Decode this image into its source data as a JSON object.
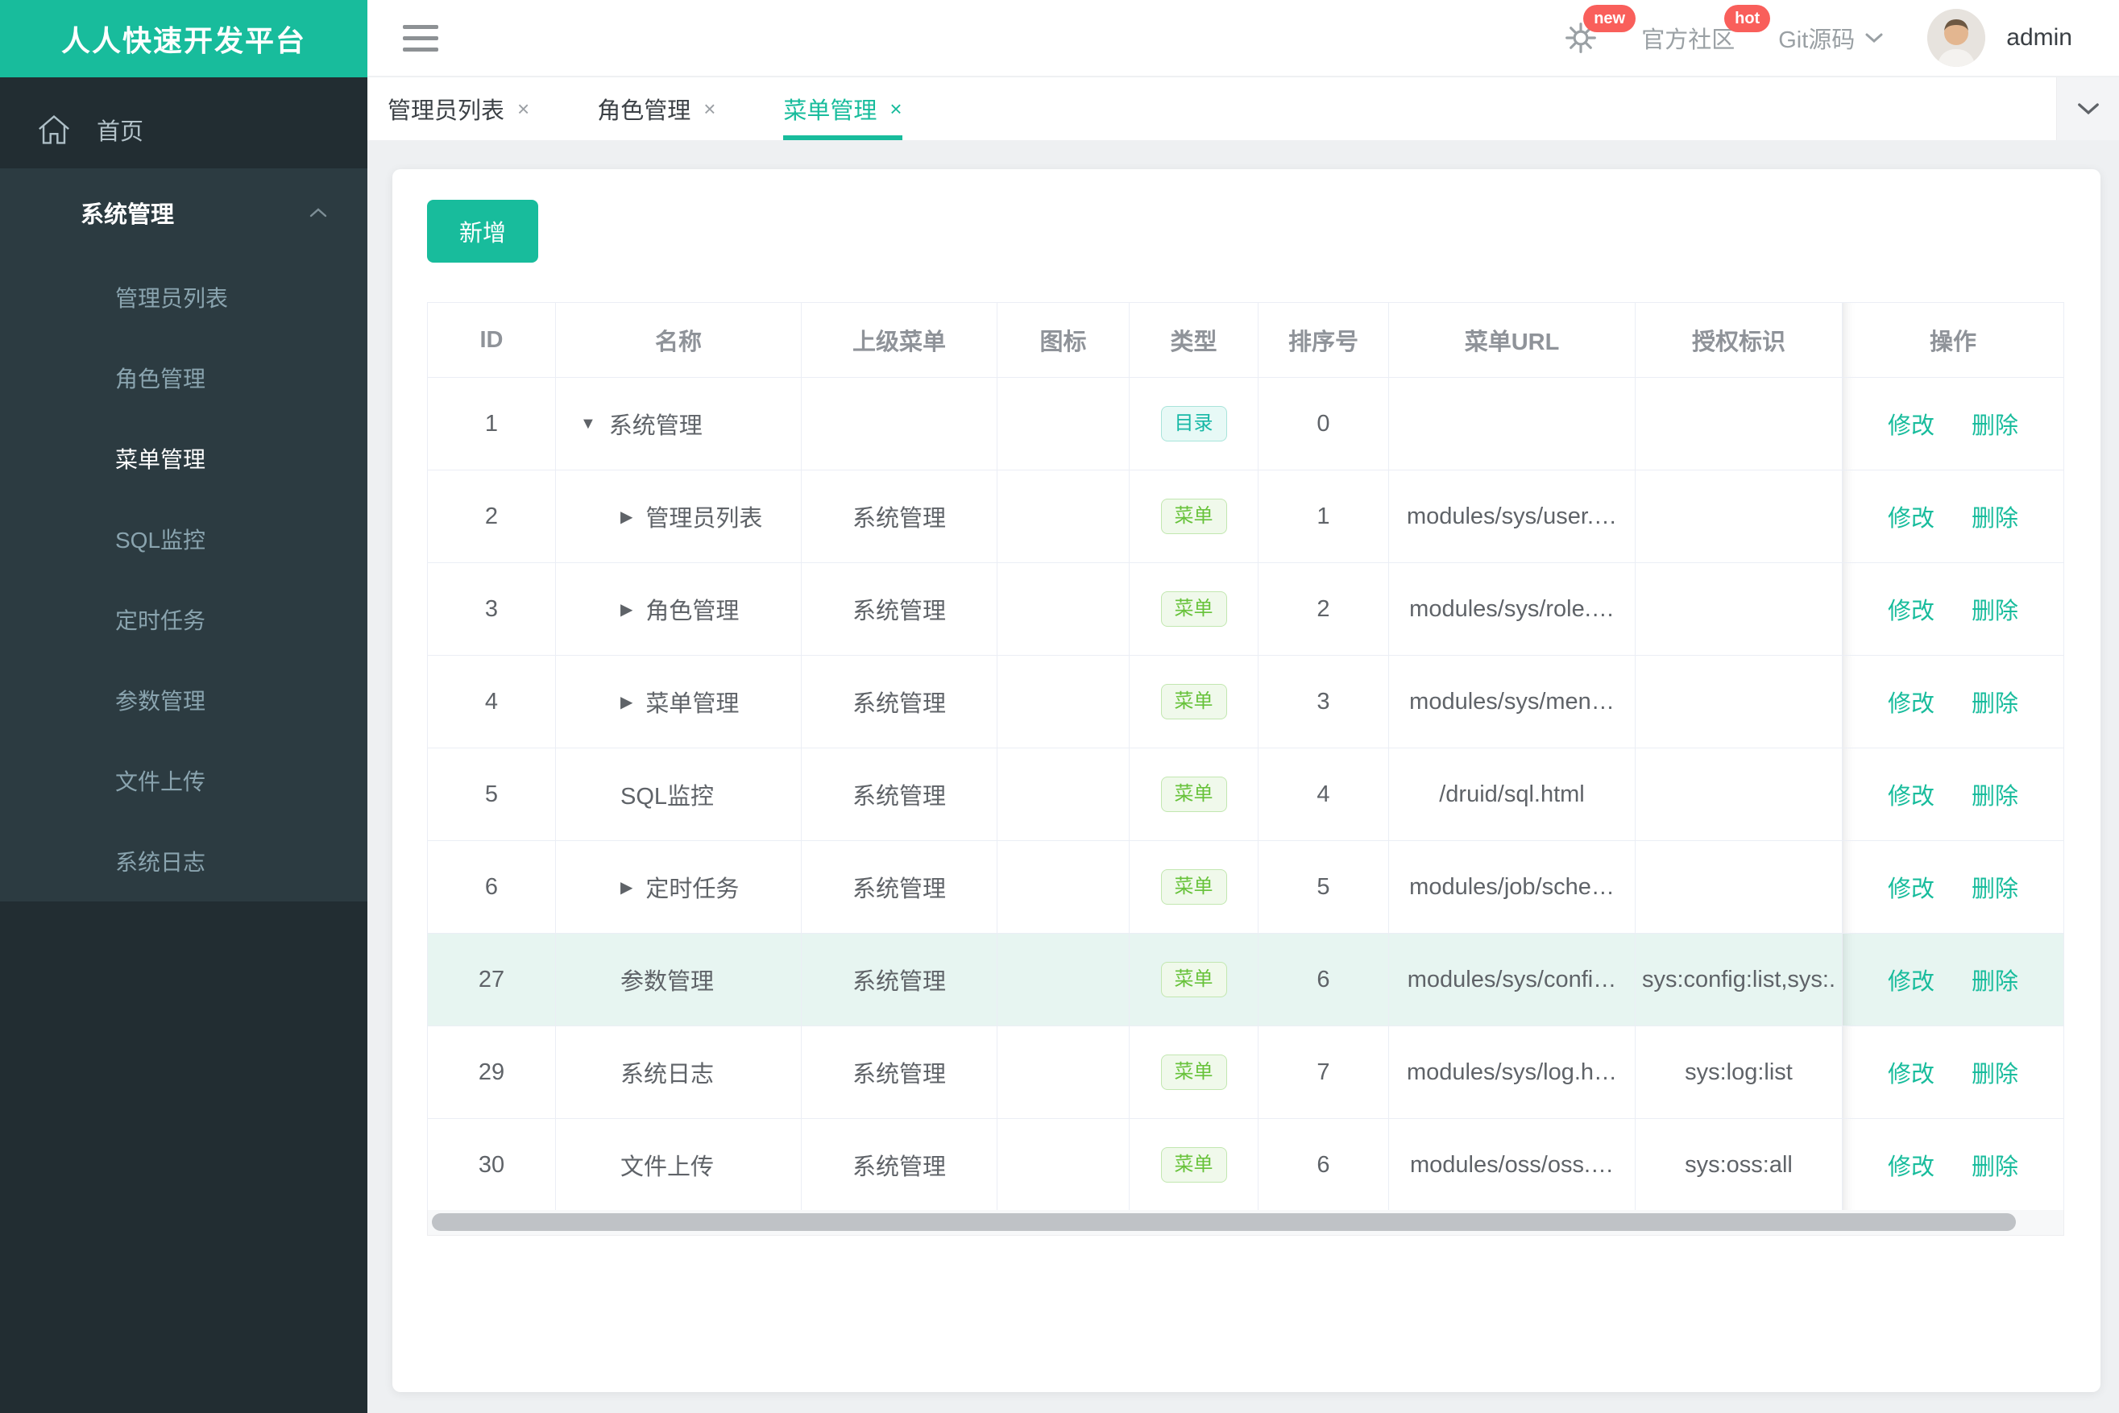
{
  "app": {
    "title": "人人快速开发平台"
  },
  "header": {
    "badge_new": "new",
    "community": "官方社区",
    "badge_hot": "hot",
    "git": "Git源码",
    "username": "admin"
  },
  "sidebar": {
    "home": "首页",
    "group": "系统管理",
    "items": [
      {
        "label": "管理员列表",
        "active": false
      },
      {
        "label": "角色管理",
        "active": false
      },
      {
        "label": "菜单管理",
        "active": true
      },
      {
        "label": "SQL监控",
        "active": false
      },
      {
        "label": "定时任务",
        "active": false
      },
      {
        "label": "参数管理",
        "active": false
      },
      {
        "label": "文件上传",
        "active": false
      },
      {
        "label": "系统日志",
        "active": false
      }
    ]
  },
  "tabs": [
    {
      "label": "管理员列表",
      "active": false
    },
    {
      "label": "角色管理",
      "active": false
    },
    {
      "label": "菜单管理",
      "active": true
    }
  ],
  "toolbar": {
    "add_label": "新增"
  },
  "icons": {
    "close_tab": "×",
    "row_collapsed": "▶",
    "row_expanded": "▼"
  },
  "table": {
    "columns": [
      "ID",
      "名称",
      "上级菜单",
      "图标",
      "类型",
      "排序号",
      "菜单URL",
      "授权标识",
      "操作"
    ],
    "types": {
      "dir": "目录",
      "menu": "菜单"
    },
    "actions": {
      "edit": "修改",
      "delete": "删除"
    },
    "rows": [
      {
        "id": "1",
        "name": "系统管理",
        "arrow": "expanded",
        "level": 0,
        "parent": "",
        "type": "dir",
        "order": "0",
        "url": "",
        "perms": "",
        "highlight": false
      },
      {
        "id": "2",
        "name": "管理员列表",
        "arrow": "collapsed",
        "level": 1,
        "parent": "系统管理",
        "type": "menu",
        "order": "1",
        "url": "modules/sys/user.…",
        "perms": "",
        "highlight": false
      },
      {
        "id": "3",
        "name": "角色管理",
        "arrow": "collapsed",
        "level": 1,
        "parent": "系统管理",
        "type": "menu",
        "order": "2",
        "url": "modules/sys/role.…",
        "perms": "",
        "highlight": false
      },
      {
        "id": "4",
        "name": "菜单管理",
        "arrow": "collapsed",
        "level": 1,
        "parent": "系统管理",
        "type": "menu",
        "order": "3",
        "url": "modules/sys/men…",
        "perms": "",
        "highlight": false
      },
      {
        "id": "5",
        "name": "SQL监控",
        "arrow": "none",
        "level": 1,
        "parent": "系统管理",
        "type": "menu",
        "order": "4",
        "url": "/druid/sql.html",
        "perms": "",
        "highlight": false
      },
      {
        "id": "6",
        "name": "定时任务",
        "arrow": "collapsed",
        "level": 1,
        "parent": "系统管理",
        "type": "menu",
        "order": "5",
        "url": "modules/job/sche…",
        "perms": "",
        "highlight": false
      },
      {
        "id": "27",
        "name": "参数管理",
        "arrow": "none",
        "level": 1,
        "parent": "系统管理",
        "type": "menu",
        "order": "6",
        "url": "modules/sys/confi…",
        "perms": "sys:config:list,sys:.",
        "highlight": true
      },
      {
        "id": "29",
        "name": "系统日志",
        "arrow": "none",
        "level": 1,
        "parent": "系统管理",
        "type": "menu",
        "order": "7",
        "url": "modules/sys/log.h…",
        "perms": "sys:log:list",
        "highlight": false
      },
      {
        "id": "30",
        "name": "文件上传",
        "arrow": "none",
        "level": 1,
        "parent": "系统管理",
        "type": "menu",
        "order": "6",
        "url": "modules/oss/oss.…",
        "perms": "sys:oss:all",
        "highlight": false
      }
    ]
  },
  "colors": {
    "accent_teal": "#18bc9c",
    "badge_red": "#f95f5b",
    "row_highlight": "#e7f5f1",
    "sidebar_bg": "#222d32",
    "sidebar_panel": "#2c3b41",
    "badge_dir_text": "#17b8a6",
    "badge_menu_text": "#67c23a",
    "cell_text": "#5f6368",
    "header_text": "#8f9399"
  }
}
